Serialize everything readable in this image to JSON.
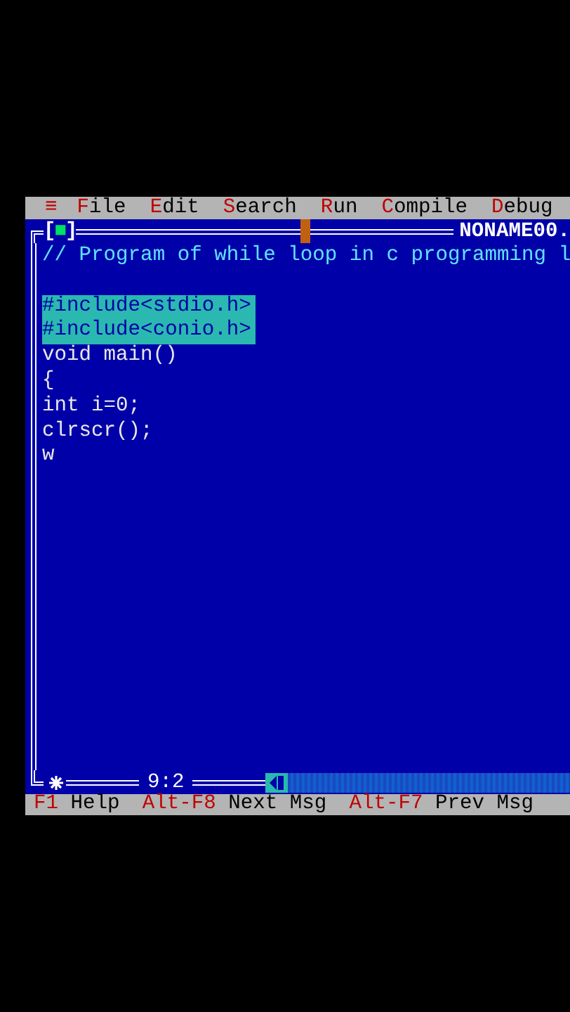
{
  "menu_bar": {
    "system_menu": "≡",
    "items": [
      "File",
      "Edit",
      "Search",
      "Run",
      "Compile",
      "Debug"
    ]
  },
  "editor": {
    "close_button": "[■]",
    "title": "NONAME00.",
    "modified": true,
    "cursor_position": "9:2",
    "lines": [
      {
        "text": "// Program of while loop in c programming l",
        "kind": "comment"
      },
      {
        "kind": "blank"
      },
      {
        "text": "#include<stdio.h>",
        "kind": "selected"
      },
      {
        "text": "#include<conio.h>",
        "kind": "selected"
      },
      {
        "text": "void main()",
        "kind": "code"
      },
      {
        "text": "{",
        "kind": "code"
      },
      {
        "text": "int i=0;",
        "kind": "code"
      },
      {
        "text": "clrscr();",
        "kind": "code"
      },
      {
        "text": "w",
        "kind": "code"
      }
    ]
  },
  "status_bar": [
    {
      "key": "F1",
      "label": "Help"
    },
    {
      "key": "Alt-F8",
      "label": "Next Msg"
    },
    {
      "key": "Alt-F7",
      "label": "Prev Msg"
    }
  ]
}
